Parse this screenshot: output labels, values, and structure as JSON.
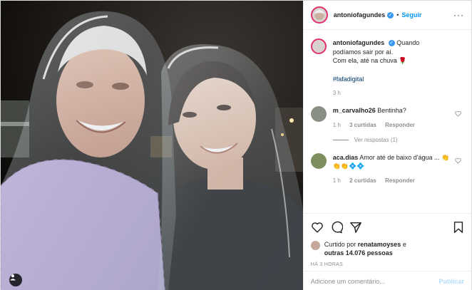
{
  "post": {
    "username": "antoniofagundes",
    "verified_mark": "✓",
    "dot": "•",
    "follow_label": "Seguir",
    "more_icon": "···"
  },
  "caption": {
    "username": "antoniofagundes",
    "text_line1": "Quando",
    "text_line2": "podíamos sair por aí.",
    "text_line3": "Com ela, até na chuva 🌹",
    "hashtag": "#fafadigital",
    "time": "3 h"
  },
  "comments": [
    {
      "username": "m_carvalho26",
      "text": "Bentinha?",
      "time": "1 h",
      "likes": "3 curtidas",
      "reply_label": "Responder",
      "view_replies": "Ver respostas (1)"
    },
    {
      "username": "aca.dias",
      "text": "Amor até de baixo d'água ... 👏👏👏💠💠",
      "time": "1 h",
      "likes": "2 curtidas",
      "reply_label": "Responder"
    }
  ],
  "likes": {
    "prefix": "Curtido por",
    "user": "renatamoyses",
    "conj": "e",
    "others": "outras 14.076 pessoas"
  },
  "timestamp": "HÁ 3 HORAS",
  "add_comment": {
    "placeholder": "Adicione um comentário...",
    "publish_label": "Publicar"
  },
  "colors": {
    "accent": "#0095f6",
    "story_ring": "#e1306c",
    "publish_disabled": "#b2dffc"
  }
}
